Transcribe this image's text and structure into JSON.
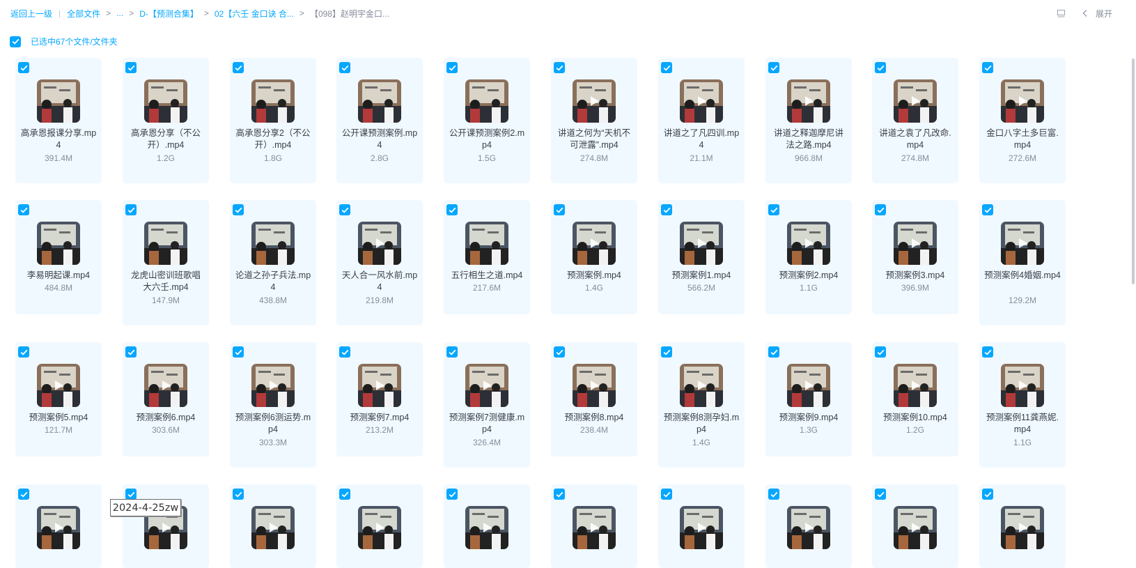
{
  "breadcrumb": {
    "back": "返回上一级",
    "all_files": "全部文件",
    "ellipsis": "...",
    "level1": "D-【预测合集】",
    "level2": "02【六壬 金口诀 合...",
    "current": "【098】赵明宇金口..."
  },
  "toolbar": {
    "expand_label": "展开"
  },
  "selection": {
    "label": "已选中67个文件/文件夹",
    "checked": true
  },
  "colors": {
    "accent": "#06a7ff",
    "tile_bg": "#f0f9ff"
  },
  "files": [
    {
      "name": "高承恩报课分享.mp4",
      "size": "391.4M"
    },
    {
      "name": "高承恩分享（不公开）.mp4",
      "size": "1.2G"
    },
    {
      "name": "高承恩分享2（不公开）.mp4",
      "size": "1.8G"
    },
    {
      "name": "公开课预测案例.mp4",
      "size": "2.8G"
    },
    {
      "name": "公开课预测案例2.mp4",
      "size": "1.5G"
    },
    {
      "name": "讲道之何为“天机不可泄露”.mp4",
      "size": "274.8M"
    },
    {
      "name": "讲道之了凡四训.mp4",
      "size": "21.1M"
    },
    {
      "name": "讲道之释迦摩尼讲法之路.mp4",
      "size": "966.8M"
    },
    {
      "name": "讲道之袁了凡改命.mp4",
      "size": "274.8M"
    },
    {
      "name": "金口八字土多巨富.mp4",
      "size": "272.6M"
    },
    {
      "name": "李易明起课.mp4",
      "size": "484.8M"
    },
    {
      "name": "龙虎山密训班歌唱大六壬.mp4",
      "size": "147.9M"
    },
    {
      "name": "论道之孙子兵法.mp4",
      "size": "438.8M"
    },
    {
      "name": "天人合一风水前.mp4",
      "size": "219.8M"
    },
    {
      "name": "五行相生之道.mp4",
      "size": "217.6M"
    },
    {
      "name": "预测案例.mp4",
      "size": "1.4G"
    },
    {
      "name": "预测案例1.mp4",
      "size": "566.2M"
    },
    {
      "name": "预测案例2.mp4",
      "size": "1.1G"
    },
    {
      "name": "预测案例3.mp4",
      "size": "396.9M"
    },
    {
      "name": "预测案例4婚姻.mp4",
      "size": "129.2M"
    },
    {
      "name": "预测案例5.mp4",
      "size": "121.7M"
    },
    {
      "name": "预测案例6.mp4",
      "size": "303.6M"
    },
    {
      "name": "预测案例6测运势.mp4",
      "size": "303.3M"
    },
    {
      "name": "预测案例7.mp4",
      "size": "213.2M"
    },
    {
      "name": "预测案例7测健康.mp4",
      "size": "326.4M"
    },
    {
      "name": "预测案例8.mp4",
      "size": "238.4M"
    },
    {
      "name": "预测案例8测孕妇.mp4",
      "size": "1.4G"
    },
    {
      "name": "预测案例9.mp4",
      "size": "1.3G"
    },
    {
      "name": "预测案例10.mp4",
      "size": "1.2G"
    },
    {
      "name": "预测案例11龚燕妮.mp4",
      "size": "1.1G"
    },
    {
      "name": "",
      "size": ""
    },
    {
      "name": "",
      "size": ""
    },
    {
      "name": "",
      "size": ""
    },
    {
      "name": "",
      "size": ""
    },
    {
      "name": "",
      "size": ""
    },
    {
      "name": "",
      "size": ""
    },
    {
      "name": "",
      "size": ""
    },
    {
      "name": "",
      "size": ""
    },
    {
      "name": "",
      "size": ""
    },
    {
      "name": "",
      "size": ""
    }
  ],
  "watermark": "2024-4-25zw"
}
